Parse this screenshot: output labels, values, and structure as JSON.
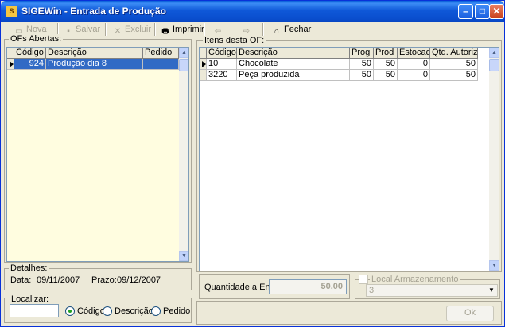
{
  "window": {
    "title": "SIGEWin - Entrada de Produção"
  },
  "toolbar": {
    "nova": "Nova",
    "salvar": "Salvar",
    "excluir": "Excluir",
    "imprimir": "Imprimir",
    "fechar": "Fechar"
  },
  "ofs": {
    "label": "OFs Abertas:",
    "columns": [
      "Código",
      "Descrição",
      "Pedido"
    ],
    "rows": [
      {
        "codigo": "924",
        "descricao": "Produção dia 8",
        "pedido": ""
      }
    ]
  },
  "detalhes": {
    "label": "Detalhes:",
    "data_label": "Data:",
    "data_value": "09/11/2007",
    "prazo_label": "Prazo:",
    "prazo_value": "09/12/2007"
  },
  "localizar": {
    "label": "Localizar:",
    "input_value": "",
    "options": [
      "Código",
      "Descrição",
      "Pedido"
    ],
    "selected": "Código"
  },
  "itens": {
    "label": "Itens desta OF:",
    "columns": [
      "Código",
      "Descrição",
      "Prog",
      "Prod",
      "Estocado",
      "Qtd. Autorizada"
    ],
    "rows": [
      {
        "codigo": "10",
        "descricao": "Chocolate",
        "prog": "50",
        "prod": "50",
        "estocado": "0",
        "qtd": "50"
      },
      {
        "codigo": "3220",
        "descricao": "Peça produzida",
        "prog": "50",
        "prod": "50",
        "estocado": "0",
        "qtd": "50"
      }
    ]
  },
  "entrada": {
    "quantidade_label": "Quantidade a Entrar:",
    "quantidade_value": "50,00",
    "local_label": "Local Armazenamento",
    "local_value": "3",
    "ok_label": "Ok"
  }
}
